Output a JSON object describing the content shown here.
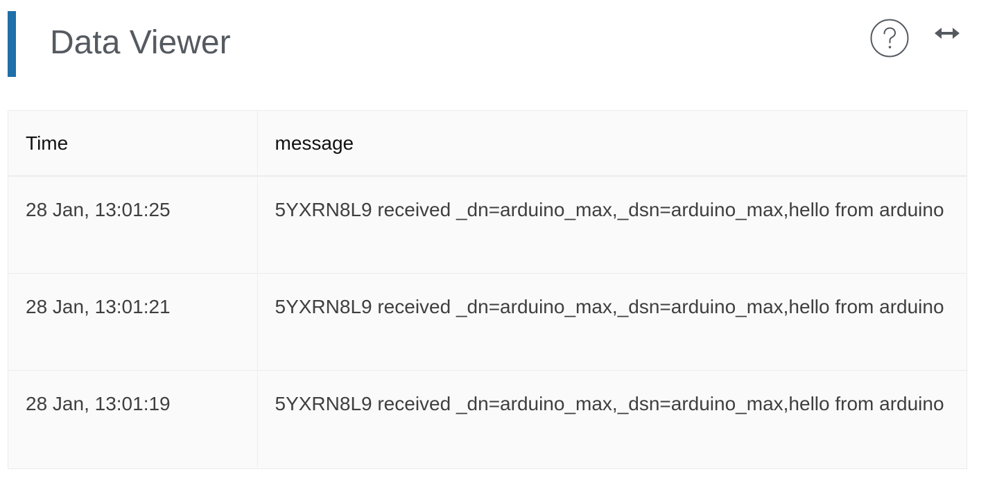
{
  "header": {
    "title": "Data Viewer",
    "accent_color": "#1f6fa8",
    "help_icon": "question-circle-icon",
    "expand_icon": "horizontal-arrows-icon"
  },
  "table": {
    "columns": [
      "Time",
      "message"
    ],
    "rows": [
      {
        "time": "28 Jan, 13:01:25",
        "message": "5YXRN8L9 received _dn=arduino_max,_dsn=arduino_max,hello from arduino"
      },
      {
        "time": "28 Jan, 13:01:21",
        "message": "5YXRN8L9 received _dn=arduino_max,_dsn=arduino_max,hello from arduino"
      },
      {
        "time": "28 Jan, 13:01:19",
        "message": "5YXRN8L9 received _dn=arduino_max,_dsn=arduino_max,hello from arduino"
      }
    ]
  }
}
